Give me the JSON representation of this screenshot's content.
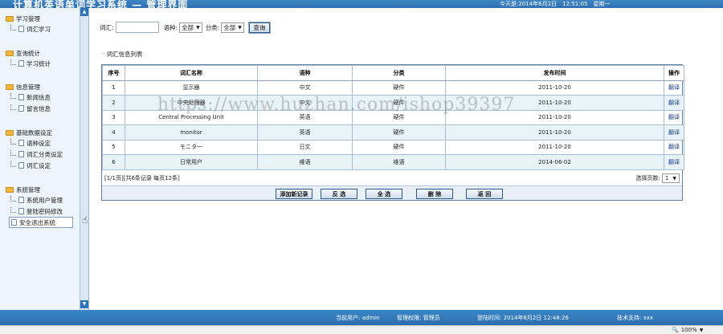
{
  "header": {
    "title": "计算机英语单词学习系统 — 管理界面",
    "date_text": "今天是:2014年6月2日　12:51:05　星期一"
  },
  "sidebar": {
    "groups": [
      {
        "title": "学习管理",
        "items": [
          "词汇学习"
        ]
      },
      {
        "title": "查询统计",
        "items": [
          "学习统计"
        ]
      },
      {
        "title": "信息管理",
        "items": [
          "新闻信息",
          "留言信息"
        ]
      },
      {
        "title": "基础数据设定",
        "items": [
          "语种设定",
          "词汇分类设定",
          "词汇设定"
        ]
      },
      {
        "title": "系统管理",
        "items": [
          "系统用户管理",
          "登陆密码修改",
          "安全退出系统"
        ]
      }
    ]
  },
  "search": {
    "vocab_label": "词汇:",
    "vocab_value": "",
    "lang_label": "语种:",
    "lang_value": "全部",
    "cat_label": "分类:",
    "cat_value": "全部",
    "query_button": "查询"
  },
  "section_title": "词汇信息列表",
  "table": {
    "columns": [
      "序号",
      "词汇名称",
      "语种",
      "分类",
      "发布时间",
      "操作"
    ],
    "rows": [
      [
        "1",
        "显示器",
        "中文",
        "硬件",
        "2011-10-20",
        "翻译"
      ],
      [
        "2",
        "中央处理器",
        "中文",
        "硬件",
        "2011-10-20",
        "翻译"
      ],
      [
        "3",
        "Central Processing Unit",
        "英语",
        "硬件",
        "2011-10-20",
        "翻译"
      ],
      [
        "4",
        "monitor",
        "英语",
        "硬件",
        "2011-10-20",
        "翻译"
      ],
      [
        "5",
        "モニタ一",
        "日文",
        "硬件",
        "2011-10-20",
        "翻译"
      ],
      [
        "6",
        "日常用户",
        "维语",
        "维语",
        "2014-06-02",
        "翻译"
      ]
    ]
  },
  "pager": {
    "summary": "[1/1页][共6条记录 每页12条]",
    "select_label": "选择页数:",
    "select_value": "1"
  },
  "actions": {
    "add": "添加新记录",
    "invert": "反 选",
    "select_all": "全 选",
    "delete": "删 除",
    "back": "返 回"
  },
  "watermark": "https://www.huzhan.com/ishop39397",
  "footer": {
    "user": "当前用户: admin",
    "role": "管理权限: 管理员",
    "login_time": "登陆时间: 2014年6月2日 12:48:26",
    "support": "技术支持: xxx"
  },
  "statusbar": {
    "zoom": "100%"
  }
}
